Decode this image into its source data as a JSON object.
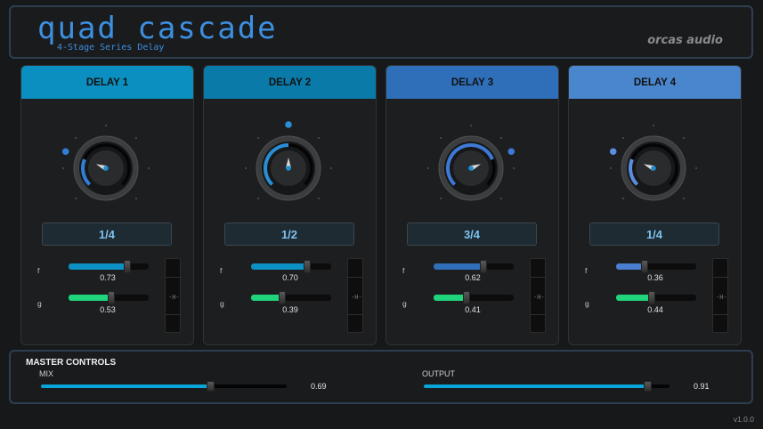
{
  "header": {
    "title": "quad cascade",
    "subtitle": "4-Stage Series Delay",
    "brand": "orcas audio"
  },
  "modules": [
    {
      "name": "DELAY 1",
      "color": "#0b8fc0",
      "arc_color": "#2f7ed8",
      "knob_value": 0.25,
      "division": "1/4",
      "f_label": "f",
      "f_value": "0.73",
      "f": 0.73,
      "f_color": "#0b91c3",
      "g_label": "g",
      "g_value": "0.53",
      "g": 0.53,
      "g_color": "#1fd47a"
    },
    {
      "name": "DELAY 2",
      "color": "#0a7aa8",
      "arc_color": "#2a8ed6",
      "knob_value": 0.5,
      "division": "1/2",
      "f_label": "f",
      "f_value": "0.70",
      "f": 0.7,
      "f_color": "#0b91c3",
      "g_label": "g",
      "g_value": "0.39",
      "g": 0.39,
      "g_color": "#1fd47a"
    },
    {
      "name": "DELAY 3",
      "color": "#2f6fba",
      "arc_color": "#3d79d6",
      "knob_value": 0.75,
      "division": "3/4",
      "f_label": "f",
      "f_value": "0.62",
      "f": 0.62,
      "f_color": "#2f6fba",
      "g_label": "g",
      "g_value": "0.41",
      "g": 0.41,
      "g_color": "#1fd47a"
    },
    {
      "name": "DELAY 4",
      "color": "#4a86ce",
      "arc_color": "#5b8de0",
      "knob_value": 0.25,
      "division": "1/4",
      "f_label": "f",
      "f_value": "0.36",
      "f": 0.36,
      "f_color": "#4a7ed0",
      "g_label": "g",
      "g_value": "0.44",
      "g": 0.44,
      "g_color": "#1fd47a"
    }
  ],
  "master": {
    "title": "MASTER CONTROLS",
    "mix_label": "MIX",
    "mix_value": "0.69",
    "mix": 0.69,
    "output_label": "OUTPUT",
    "output_value": "0.91",
    "output": 0.91
  },
  "version": "v1.0.0"
}
